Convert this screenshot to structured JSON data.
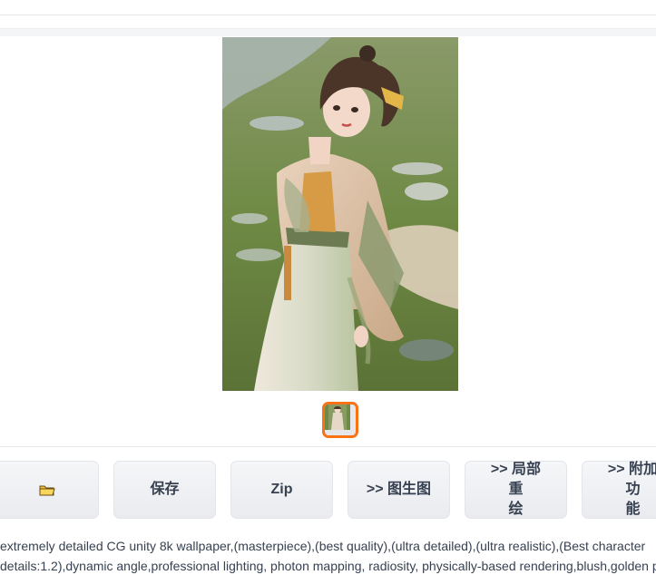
{
  "buttons": {
    "folder_icon": "folder-icon",
    "save_label": "保存",
    "zip_label": "Zip",
    "img2img_label": ">> 图生图",
    "inpaint_label_line1": ">> 局部重",
    "inpaint_label_line2": "绘",
    "extras_label_line1": ">> 附加功",
    "extras_label_line2": "能"
  },
  "gallery": {
    "selected_thumbnail_border": "#f97316"
  },
  "prompt": {
    "line1": "extremely detailed CG unity 8k wallpaper,(masterpiece),(best quality),(ultra detailed),(ultra realistic),(Best character",
    "line2": "details:1.2),dynamic angle,professional lighting, photon mapping, radiosity, physically-based rendering,blush,golden proport"
  }
}
